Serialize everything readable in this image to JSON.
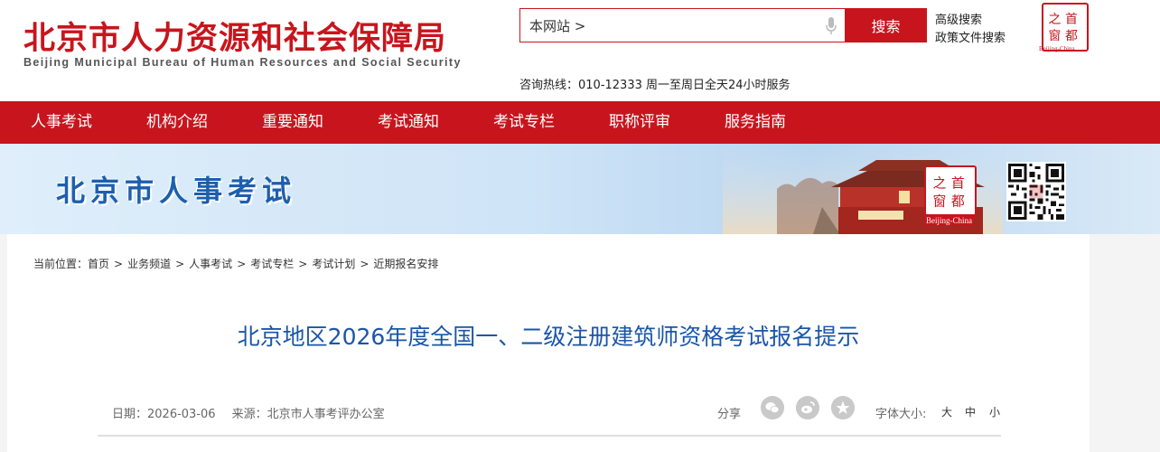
{
  "header": {
    "logo_cn": "北京市人力资源和社会保障局",
    "logo_en": "Beijing Municipal Bureau of Human Resources and Social Security",
    "search": {
      "value": "本网站 >",
      "button_label": "搜索"
    },
    "advanced_search": "高级搜索",
    "policy_search": "政策文件搜索",
    "hotline": "咨询热线：010-12333 周一至周日全天24小时服务",
    "seal": {
      "char1": "之",
      "char2": "首",
      "char3": "窗",
      "char4": "都",
      "caption": "Beijing-China"
    }
  },
  "nav": {
    "items": [
      "人事考试",
      "机构介绍",
      "重要通知",
      "考试通知",
      "考试专栏",
      "职称评审",
      "服务指南"
    ]
  },
  "banner": {
    "title": "北京市人事考试",
    "seal": {
      "char1": "之",
      "char2": "首",
      "char3": "窗",
      "char4": "都",
      "caption": "Beijing-China"
    }
  },
  "breadcrumb": {
    "label": "当前位置：",
    "items": [
      "首页",
      "业务频道",
      "人事考试",
      "考试专栏",
      "考试计划",
      "近期报名安排"
    ]
  },
  "article": {
    "title": "北京地区2026年度全国一、二级注册建筑师资格考试报名提示",
    "date": "日期：2026-03-06",
    "source": "来源：北京市人事考评办公室",
    "share_label": "分享",
    "font_size_label": "字体大小:",
    "font_sizes": [
      "大",
      "中",
      "小"
    ]
  },
  "colors": {
    "brand_red": "#c8151d",
    "title_blue": "#1a56a8",
    "banner_blue": "#1d5fae"
  },
  "icons": [
    "mic-icon",
    "wechat-icon",
    "weibo-icon",
    "star-icon",
    "qr-code-icon"
  ]
}
